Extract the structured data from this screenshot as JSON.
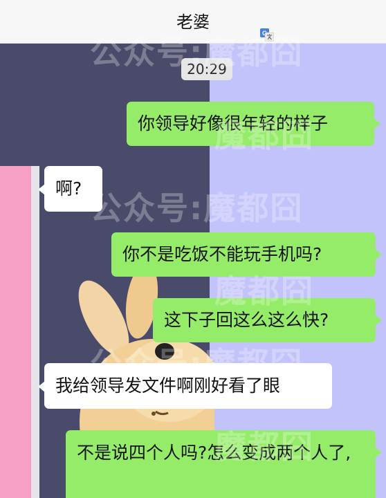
{
  "header": {
    "title": "老婆",
    "translate_icon": "translate-icon"
  },
  "timestamp": "20:29",
  "messages": [
    {
      "sender": "me",
      "text": "你领导好像很年轻的样子"
    },
    {
      "sender": "other",
      "text": "啊?"
    },
    {
      "sender": "me",
      "text": "你不是吃饭不能玩手机吗?"
    },
    {
      "sender": "me",
      "text": "这下子回这么这么快?"
    },
    {
      "sender": "other",
      "text": "我给领导发文件啊刚好看了眼"
    },
    {
      "sender": "me",
      "text": "不是说四个人吗?怎么变成两个人了,"
    }
  ],
  "watermark": {
    "account": "公众号:魔都囧",
    "name": "魔都囧"
  },
  "colors": {
    "my_bubble": "#95ec69",
    "their_bubble": "#ffffff",
    "wallpaper_left": "#4a4a6a",
    "wallpaper_right": "#c3c3fb",
    "wallpaper_pink": "#f6a0c6"
  }
}
